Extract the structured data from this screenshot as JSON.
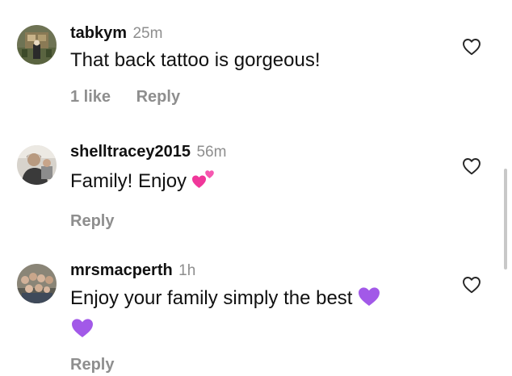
{
  "comments": [
    {
      "username": "tabkym",
      "time": "25m",
      "text": "That back tattoo is gorgeous!",
      "likes": "1 like",
      "reply": "Reply",
      "emoji": []
    },
    {
      "username": "shelltracey2015",
      "time": "56m",
      "text": "Family! Enjoy",
      "reply": "Reply",
      "emoji": [
        "two-hearts"
      ]
    },
    {
      "username": "mrsmacperth",
      "time": "1h",
      "text": "Enjoy your family simply the best",
      "reply": "Reply",
      "emoji": [
        "purple-heart",
        "purple-heart"
      ]
    }
  ],
  "colors": {
    "text": "#111111",
    "muted": "#8e8e8e",
    "pink": "#f0379a",
    "purple": "#a259e8"
  },
  "icons": {
    "like": "heart-outline-icon",
    "two_hearts": "two-hearts-emoji",
    "purple_heart": "purple-heart-emoji"
  }
}
